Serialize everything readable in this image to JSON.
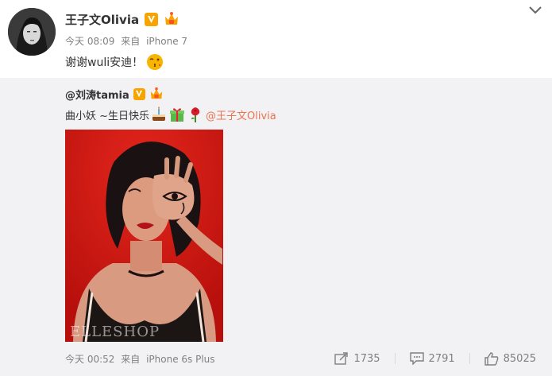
{
  "post": {
    "author": "王子文Olivia",
    "verified_badge": "V",
    "time": "今天 08:09",
    "source_prefix": "来自",
    "source": "iPhone 7",
    "text": "谢谢wuli安迪！",
    "emoji": "kiss-face-icon"
  },
  "repost": {
    "author": "@刘涛tamia",
    "verified_badge": "V",
    "text": "曲小妖 ~生日快乐",
    "emojis": [
      "cake-icon",
      "gift-icon",
      "rose-icon"
    ],
    "mention": "@王子文Olivia",
    "image_watermark": "ELLESHOP",
    "time": "今天 00:52",
    "source_prefix": "来自",
    "source": "iPhone 6s Plus",
    "stats": {
      "reposts": "1735",
      "comments": "2791",
      "likes": "85025"
    }
  },
  "colors": {
    "mention": "#eb7350",
    "verified": "#f7a400",
    "repost_bg": "#f2f2f5",
    "meta": "#808080"
  }
}
